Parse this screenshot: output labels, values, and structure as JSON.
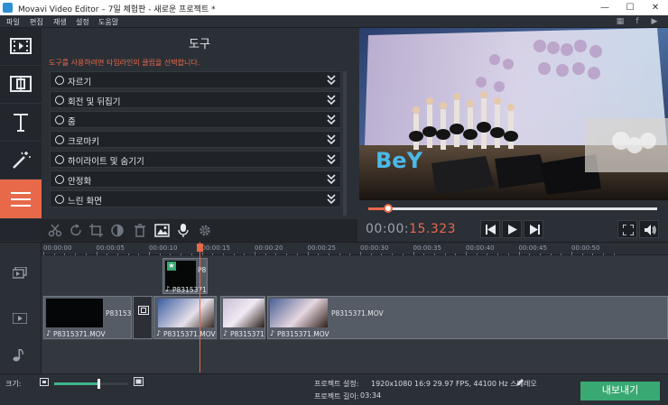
{
  "window": {
    "title": "Movavi Video Editor – 7일 체험판 - 새로운 프로젝트 *",
    "minimize": "—",
    "maximize": "☐",
    "close": "✕"
  },
  "menu": {
    "items": [
      "파일",
      "편집",
      "재생",
      "설정",
      "도움말"
    ]
  },
  "sidebar": {
    "buttons": [
      {
        "name": "import",
        "icon": "film-icon"
      },
      {
        "name": "transitions",
        "icon": "transition-icon"
      },
      {
        "name": "titles",
        "icon": "text-t-icon"
      },
      {
        "name": "filters",
        "icon": "magic-wand-icon"
      },
      {
        "name": "more-tools",
        "icon": "hamburger-menu-icon",
        "active": true
      }
    ]
  },
  "tools": {
    "title": "도구",
    "hint": "도구를 사용하려면 타임라인의 클립을 선택합니다.",
    "items": [
      {
        "label": "자르기"
      },
      {
        "label": "회전 및 뒤집기"
      },
      {
        "label": "줌"
      },
      {
        "label": "크로마키"
      },
      {
        "label": "하이라이트 및 숨기기"
      },
      {
        "label": "안정화"
      },
      {
        "label": "느린 화면"
      }
    ]
  },
  "edit_toolbar": {
    "tools": [
      "scissors-icon",
      "rotate-icon",
      "crop-icon",
      "color-adjust-icon",
      "trash-icon",
      "image-icon",
      "microphone-icon",
      "gear-icon"
    ]
  },
  "playback": {
    "timecode_main": "00:00:",
    "timecode_sec": "15.323",
    "progress": 0.07
  },
  "timeline": {
    "ruler": [
      "00:00:00",
      "00:00:05",
      "00:00:10",
      "00:00:15",
      "00:00:20",
      "00:00:25",
      "00:00:30",
      "00:00:35",
      "00:00:40",
      "00:00:45",
      "00:00:50"
    ],
    "overlay_clip": {
      "name": "P8",
      "audio": "P8315371."
    },
    "video_clips": [
      {
        "name": "P831537",
        "audio": "P8315371.MOV"
      },
      {
        "name": "",
        "audio": "P8315371.MOV"
      },
      {
        "name": "",
        "audio": "P8315371."
      },
      {
        "name": "P8315371.MOV",
        "audio": "P8315371.MOV"
      }
    ]
  },
  "status": {
    "zoom_label": "크기:",
    "zoom_level": 0.6,
    "project_settings_label": "프로젝트 설정:",
    "project_settings_value": "1920x1080 16:9 29.97 FPS, 44100 Hz 스테레오",
    "project_length_label": "프로젝트 길이:",
    "project_length_value": "03:34",
    "export_label": "내보내기"
  },
  "colors": {
    "accent": "#e8694a",
    "export": "#3aa872",
    "background": "#2b2f36"
  }
}
